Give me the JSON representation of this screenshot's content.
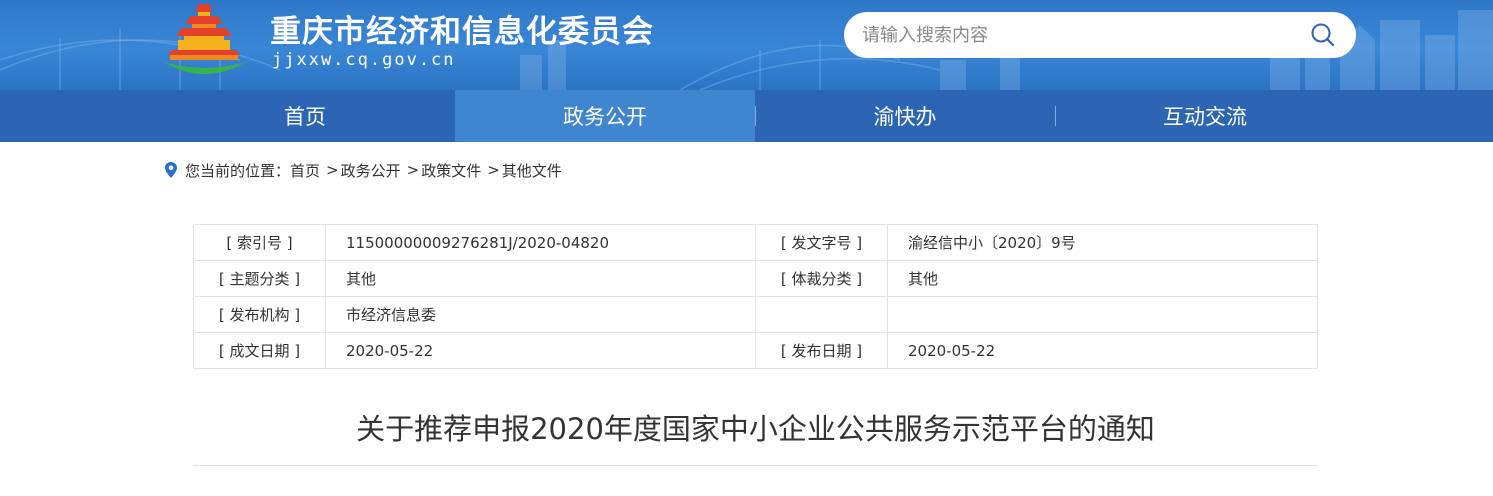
{
  "header": {
    "site_title": "重庆市经济和信息化委员会",
    "site_domain": "jjxxw.cq.gov.cn",
    "search_placeholder": "请输入搜索内容",
    "search_value": ""
  },
  "nav": {
    "items": [
      {
        "label": "首页"
      },
      {
        "label": "政务公开",
        "active": true
      },
      {
        "label": "渝快办"
      },
      {
        "label": "互动交流"
      }
    ]
  },
  "breadcrumb": {
    "prefix": "您当前的位置：",
    "items": [
      "首页",
      "政务公开",
      "政策文件",
      "其他文件"
    ],
    "separator": ">"
  },
  "info": {
    "rows": [
      [
        {
          "label": "[ 索引号 ]",
          "value": "11500000009276281J/2020-04820"
        },
        {
          "label": "[ 发文字号 ]",
          "value": "渝经信中小〔2020〕9号"
        }
      ],
      [
        {
          "label": "[ 主题分类 ]",
          "value": "其他"
        },
        {
          "label": "[ 体裁分类 ]",
          "value": "其他"
        }
      ],
      [
        {
          "label": "[ 发布机构 ]",
          "value": "市经济信息委"
        },
        {
          "label": "",
          "value": ""
        }
      ],
      [
        {
          "label": "[ 成文日期 ]",
          "value": "2020-05-22"
        },
        {
          "label": "[ 发布日期 ]",
          "value": "2020-05-22"
        }
      ]
    ]
  },
  "article": {
    "title": "关于推荐申报2020年度国家中小企业公共服务示范平台的通知"
  },
  "colors": {
    "header_blue": "#3a86d6",
    "nav_blue": "#2b65b3",
    "nav_active": "#3f85cf",
    "pin_blue": "#2b6fc4"
  }
}
